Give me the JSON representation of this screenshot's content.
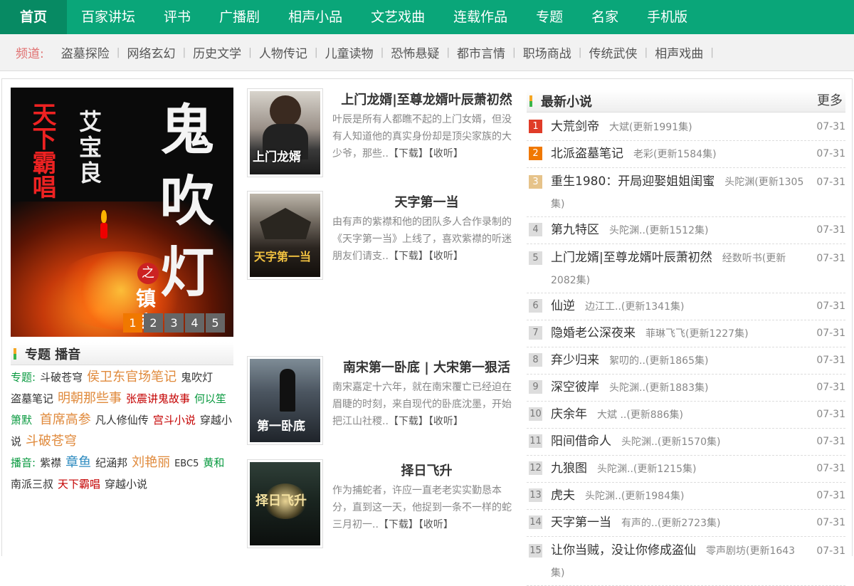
{
  "nav": [
    "首页",
    "百家讲坛",
    "评书",
    "广播剧",
    "相声小品",
    "文艺戏曲",
    "连载作品",
    "专题",
    "名家",
    "手机版"
  ],
  "channels": {
    "label": "频道:",
    "items": [
      "盗墓探险",
      "网络玄幻",
      "历史文学",
      "人物传记",
      "儿童读物",
      "恐怖悬疑",
      "都市言情",
      "职场商战",
      "传统武侠",
      "相声戏曲"
    ]
  },
  "banner": {
    "red_title": "天下霸唱",
    "author": "艾宝良",
    "big_title": "鬼吹灯",
    "zhi": "之",
    "subtitle": "镇库狂沙",
    "pages": [
      "1",
      "2",
      "3",
      "4",
      "5"
    ]
  },
  "topics": {
    "title": "专题 播音",
    "topic_label": "专题:",
    "topic_items": [
      "斗破苍穹",
      "侯卫东官场笔记",
      "鬼吹灯",
      "盗墓笔记",
      "明朝那些事",
      "张震讲鬼故事",
      "何以笙箫默",
      "首席高参",
      "凡人修仙传",
      "宫斗小说",
      "穿越小说",
      "斗破苍穹"
    ],
    "voice_label": "播音:",
    "voice_items": [
      "紫襟",
      "章鱼",
      "纪涵邦",
      "刘艳丽",
      "EBC5",
      "黄和",
      "南派三叔",
      "天下霸唱",
      "穿越小说"
    ]
  },
  "featured": [
    {
      "title": "上门龙婿|至尊龙婿叶辰萧初然",
      "desc": "叶辰是所有人都瞧不起的上门女婿，但没有人知道他的真实身份却是顶尖家族的大少爷，那些..",
      "dl": "【下载】",
      "listen": "【收听】",
      "cover_text": "上门龙婿"
    },
    {
      "title": "天字第一当",
      "desc": "由有声的紫襟和他的团队多人合作录制的《天字第一当》上线了，喜欢紫襟的听迷朋友们请支..",
      "dl": "【下载】",
      "listen": "【收听】",
      "cover_text": "天字第一当"
    },
    {
      "title": "南宋第一卧底 | 大宋第一狠活",
      "desc": "南宋嘉定十六年，就在南宋覆亡已经迫在眉睫的时刻，来自现代的卧底沈墨，开始把江山社稷..",
      "dl": "【下载】",
      "listen": "【收听】",
      "cover_text": "第一卧底"
    },
    {
      "title": "择日飞升",
      "desc": "作为捕蛇者，许应一直老老实实勤恳本分，直到这一天，他捉到一条不一样的蛇 三月初一..",
      "dl": "【下载】",
      "listen": "【收听】",
      "cover_text": "择日飞升"
    }
  ],
  "latest": {
    "title": "最新小说",
    "more": "更多",
    "items": [
      {
        "n": "1",
        "name": "大荒剑帝",
        "au": "大斌(更新1991集)",
        "date": "07-31"
      },
      {
        "n": "2",
        "name": "北派盗墓笔记",
        "au": "老彩(更新1584集)",
        "date": "07-31"
      },
      {
        "n": "3",
        "name": "重生1980：开局迎娶姐姐闺蜜",
        "au": "头陀渊(更新1305集)",
        "date": "07-31"
      },
      {
        "n": "4",
        "name": "第九特区",
        "au": "头陀渊..(更新1512集)",
        "date": "07-31"
      },
      {
        "n": "5",
        "name": "上门龙婿|至尊龙婿叶辰萧初然",
        "au": "经数听书(更新2082集)",
        "date": "07-31"
      },
      {
        "n": "6",
        "name": "仙逆",
        "au": "边江工..(更新1341集)",
        "date": "07-31"
      },
      {
        "n": "7",
        "name": "隐婚老公深夜来",
        "au": "菲琳飞飞(更新1227集)",
        "date": "07-31"
      },
      {
        "n": "8",
        "name": "弃少归来",
        "au": "絮叨的..(更新1865集)",
        "date": "07-31"
      },
      {
        "n": "9",
        "name": "深空彼岸",
        "au": "头陀渊..(更新1883集)",
        "date": "07-31"
      },
      {
        "n": "10",
        "name": "庆余年",
        "au": "大斌 ..(更新886集)",
        "date": "07-31"
      },
      {
        "n": "11",
        "name": "阳间借命人",
        "au": "头陀渊..(更新1570集)",
        "date": "07-31"
      },
      {
        "n": "12",
        "name": "九狼图",
        "au": "头陀渊..(更新1215集)",
        "date": "07-31"
      },
      {
        "n": "13",
        "name": "虎夫",
        "au": "头陀渊..(更新1984集)",
        "date": "07-31"
      },
      {
        "n": "14",
        "name": "天字第一当",
        "au": "有声的..(更新2723集)",
        "date": "07-31"
      },
      {
        "n": "15",
        "name": "让你当贼，没让你修成盗仙",
        "au": "零声剧坊(更新1643集)",
        "date": "07-31"
      }
    ]
  }
}
